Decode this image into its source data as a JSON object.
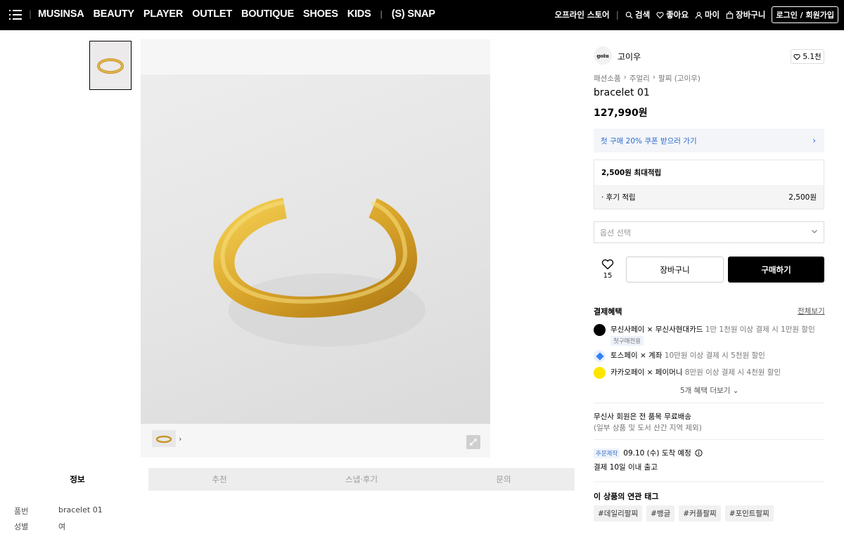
{
  "nav": {
    "brands": [
      "MUSINSA",
      "BEAUTY",
      "PLAYER",
      "OUTLET",
      "BOUTIQUE",
      "SHOES",
      "KIDS"
    ],
    "snap": "(S) SNAP",
    "offline": "오프라인 스토어",
    "search": "검색",
    "likes": "좋아요",
    "my": "마이",
    "cart": "장바구니",
    "login": "로그인 / 회원가입"
  },
  "tabs": [
    "정보",
    "추천",
    "스냅·후기",
    "문의"
  ],
  "info": [
    {
      "k": "품번",
      "v": "bracelet 01"
    },
    {
      "k": "성별",
      "v": "여"
    }
  ],
  "product": {
    "brand_logo_text": "goiu",
    "brand": "고이우",
    "fav_count": "5.1천",
    "breadcrumb": [
      "패션소품",
      "주얼리",
      "팔찌 (고이우)"
    ],
    "title": "bracelet 01",
    "price": "127,990원",
    "coupon": "첫 구매 20% 쿠폰 받으러 가기",
    "points_max": "2,500원 최대적립",
    "review_points_label": "· 후기 적립",
    "review_points_value": "2,500원",
    "option_placeholder": "옵션 선택",
    "like_count": "15",
    "cart_btn": "장바구니",
    "buy_btn": "구매하기"
  },
  "payment": {
    "title": "결제혜택",
    "view_all": "전체보기",
    "items": [
      {
        "name": "무신사페이 × 무신사현대카드",
        "desc": "1만 1천원 이상 결제 시 1만원 할인",
        "badge": "첫구매전용",
        "color": "#000000"
      },
      {
        "name": "토스페이 × 계좌",
        "desc": "10만원 이상 결제 시 5천원 할인",
        "color": "#3182f6"
      },
      {
        "name": "카카오페이 × 페이머니",
        "desc": "8만원 이상 결제 시 4천원 할인",
        "color": "#fee500"
      }
    ],
    "more": "5개 혜택 더보기"
  },
  "shipping": {
    "line1": "무신사 회원은 전 품목 무료배송",
    "line2": "(일부 상품 및 도서 산간 지역 제외)",
    "tag": "주문제작",
    "arrival": "09.10 (수) 도착 예정",
    "dispatch": "결제 10일 이내 출고"
  },
  "tags": {
    "title": "이 상품의 연관 태그",
    "items": [
      "#데일리팔찌",
      "#뱅글",
      "#커플팔찌",
      "#포인트팔찌"
    ]
  }
}
